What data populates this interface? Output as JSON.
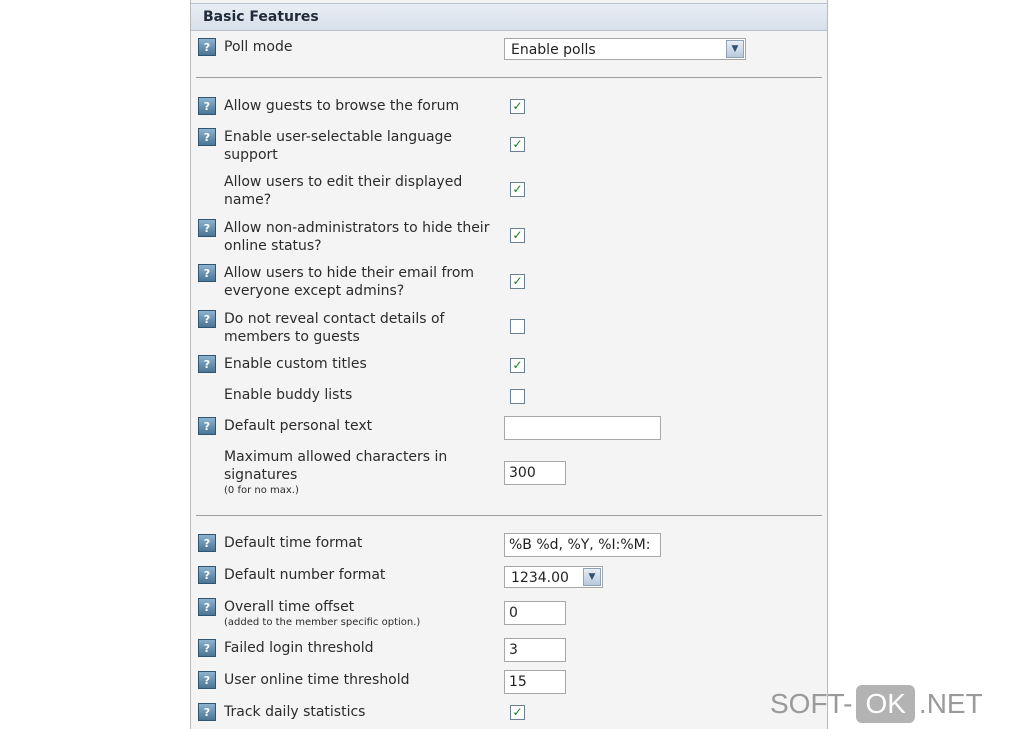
{
  "section": {
    "title": "Basic Features"
  },
  "settings": [
    {
      "label": "Poll mode",
      "control": "select",
      "value": "Enable polls"
    },
    {
      "label": "Allow guests to browse the forum",
      "control": "checkbox",
      "checked": true
    },
    {
      "label": "Enable user-selectable language support",
      "control": "checkbox",
      "checked": true
    },
    {
      "label": "Allow users to edit their displayed name?",
      "control": "checkbox",
      "checked": true
    },
    {
      "label": "Allow non-administrators to hide their online status?",
      "control": "checkbox",
      "checked": true
    },
    {
      "label": "Allow users to hide their email from everyone except admins?",
      "control": "checkbox",
      "checked": true
    },
    {
      "label": "Do not reveal contact details of members to guests",
      "control": "checkbox",
      "checked": false
    },
    {
      "label": "Enable custom titles",
      "control": "checkbox",
      "checked": true
    },
    {
      "label": "Enable buddy lists",
      "control": "checkbox",
      "checked": false
    },
    {
      "label": "Default personal text",
      "control": "text",
      "value": ""
    },
    {
      "label": "Maximum allowed characters in signatures",
      "note": "(0 for no max.)",
      "control": "text",
      "value": "300"
    },
    {
      "label": "Default time format",
      "control": "text",
      "value": "%B %d, %Y, %I:%M:"
    },
    {
      "label": "Default number format",
      "control": "select",
      "value": "1234.00"
    },
    {
      "label": "Overall time offset",
      "note": "(added to the member specific option.)",
      "control": "text",
      "value": "0"
    },
    {
      "label": "Failed login threshold",
      "control": "text",
      "value": "3"
    },
    {
      "label": "User online time threshold",
      "control": "text",
      "value": "15"
    },
    {
      "label": "Track daily statistics",
      "control": "checkbox",
      "checked": true
    }
  ],
  "icons": {
    "help": "help-icon",
    "check_glyph": "✓",
    "dropdown": "chevron-down-icon"
  },
  "watermark": {
    "left": "SOFT-",
    "badge": "OK",
    "right": ".NET"
  },
  "colors": {
    "header_bg": "#d7dfea",
    "panel_bg": "#f4f4f4",
    "check_color": "#1a7d1a"
  }
}
